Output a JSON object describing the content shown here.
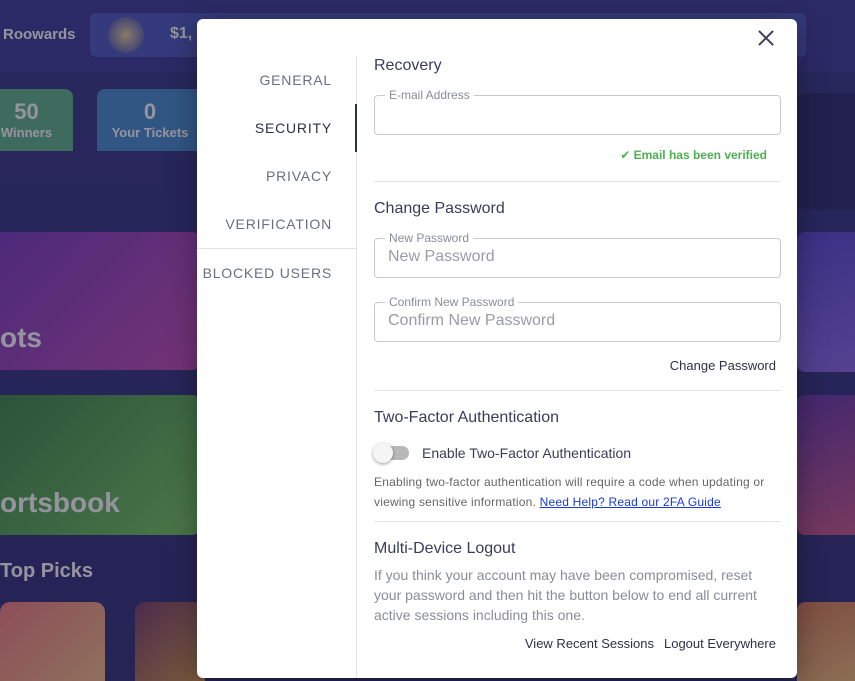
{
  "background": {
    "brand": "Roowards",
    "wallet_amount": "$1,",
    "stats": [
      {
        "value": "50",
        "label": "Winners"
      },
      {
        "value": "0",
        "label": "Your Tickets"
      }
    ],
    "banners": [
      "ots",
      "ortsbook"
    ],
    "section_title": "Top Picks"
  },
  "modal": {
    "nav": [
      "GENERAL",
      "SECURITY",
      "PRIVACY",
      "VERIFICATION",
      "BLOCKED USERS"
    ],
    "active_nav": "SECURITY",
    "recovery": {
      "title": "Recovery",
      "email_label": "E-mail Address",
      "email_value": "",
      "verified_text": "Email has been verified"
    },
    "change_password": {
      "title": "Change Password",
      "new_label": "New Password",
      "new_placeholder": "New Password",
      "confirm_label": "Confirm New Password",
      "confirm_placeholder": "Confirm New Password",
      "submit": "Change Password"
    },
    "two_factor": {
      "title": "Two-Factor Authentication",
      "toggle_label": "Enable Two-Factor Authentication",
      "enabled": false,
      "description": "Enabling two-factor authentication will require a code when updating or viewing sensitive information.",
      "help_link": "Need Help? Read our 2FA Guide"
    },
    "logout": {
      "title": "Multi-Device Logout",
      "description": "If you think your account may have been compromised, reset your password and then hit the button below to end all current active sessions including this one.",
      "view_sessions": "View Recent Sessions",
      "logout_all": "Logout Everywhere"
    }
  }
}
